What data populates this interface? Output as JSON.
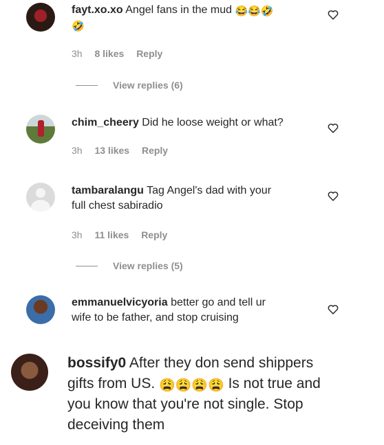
{
  "comments": [
    {
      "username": "fayt.xo.xo",
      "text": "Angel fans in the mud",
      "emojis": [
        "😂",
        "😂",
        "🤣",
        "🤣"
      ],
      "time": "3h",
      "likes": "8 likes",
      "reply": "Reply",
      "view_replies": "View replies (6)"
    },
    {
      "username": "chim_cheery",
      "text": "Did he loose weight or what?",
      "time": "3h",
      "likes": "13 likes",
      "reply": "Reply"
    },
    {
      "username": "tambaralangu",
      "text_line1": "Tag Angel's dad with your",
      "text_line2": "full chest sabiradio",
      "time": "3h",
      "likes": "11 likes",
      "reply": "Reply",
      "view_replies": "View replies (5)"
    },
    {
      "username": "emmanuelvicyoria",
      "text_line1": "better go and tell ur",
      "text_line2": "wife to be father, and stop cruising"
    },
    {
      "username": "bossify0",
      "text_line1": "After they don send shippers",
      "text_line2_prefix": "gifts from US.",
      "emojis": [
        "😩",
        "😩",
        "😩",
        "😩"
      ],
      "text_line2_suffix": "Is not true and",
      "text_line3": "you know that you're not single. Stop",
      "text_line4": "deceiving them"
    }
  ]
}
